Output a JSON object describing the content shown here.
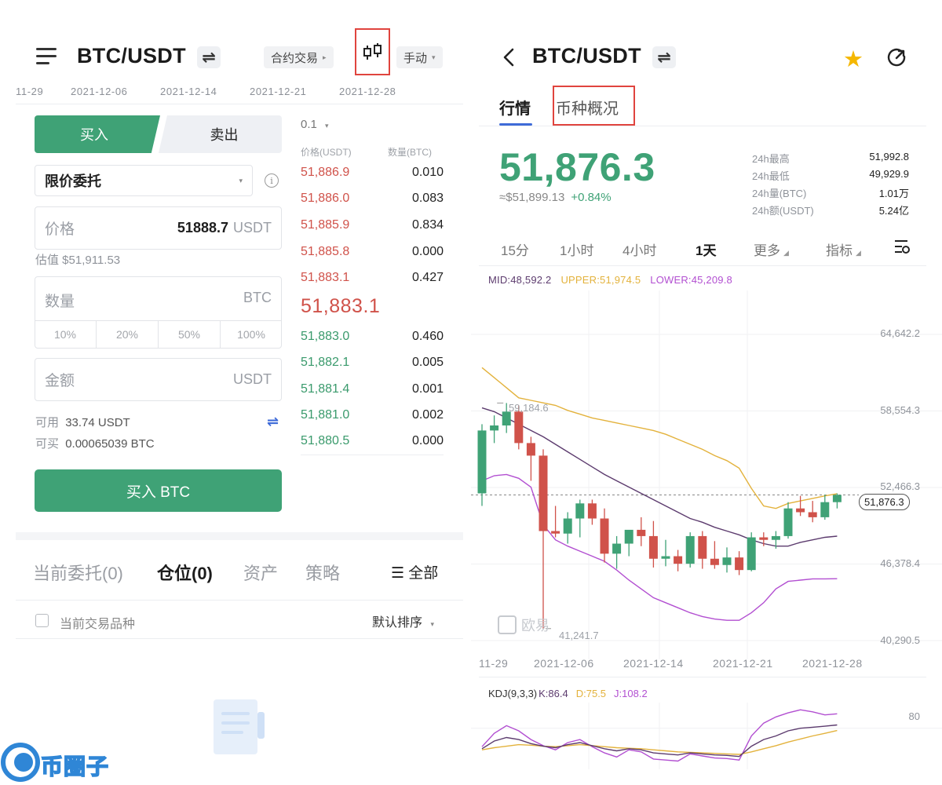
{
  "left": {
    "pair": "BTC/USDT",
    "swap_glyph": "⇌",
    "contract_label": "合约交易",
    "contract_arrow": "▸",
    "mode_label": "手动",
    "mode_caret": "▾",
    "dates": [
      "11-29",
      "2021-12-06",
      "2021-12-14",
      "2021-12-21",
      "2021-12-28"
    ],
    "buy_tab": "买入",
    "sell_tab": "卖出",
    "order_type": "限价委托",
    "order_type_caret": "▾",
    "info_glyph": "i",
    "price_label": "价格",
    "price_value": "51888.7",
    "price_unit": "USDT",
    "estimate": "估值 $51,911.53",
    "qty_label": "数量",
    "qty_unit": "BTC",
    "pcts": [
      "10%",
      "20%",
      "50%",
      "100%"
    ],
    "amount_label": "金额",
    "amount_unit": "USDT",
    "avail_label": "可用",
    "avail_value": "33.74 USDT",
    "canbuy_label": "可买",
    "canbuy_value": "0.00065039 BTC",
    "transfer_glyph": "⇌",
    "buy_button": "买入 BTC",
    "orderbook": {
      "step": "0.1",
      "step_caret": "▾",
      "head_price": "价格(USDT)",
      "head_qty": "数量(BTC)",
      "asks": [
        {
          "p": "51,886.9",
          "q": "0.010"
        },
        {
          "p": "51,886.0",
          "q": "0.083"
        },
        {
          "p": "51,885.9",
          "q": "0.834"
        },
        {
          "p": "51,885.8",
          "q": "0.000"
        },
        {
          "p": "51,883.1",
          "q": "0.427"
        }
      ],
      "mid": "51,883.1",
      "bids": [
        {
          "p": "51,883.0",
          "q": "0.460"
        },
        {
          "p": "51,882.1",
          "q": "0.005"
        },
        {
          "p": "51,881.4",
          "q": "0.001"
        },
        {
          "p": "51,881.0",
          "q": "0.002"
        },
        {
          "p": "51,880.5",
          "q": "0.000"
        }
      ]
    },
    "bottom_tabs": [
      "当前委托(0)",
      "仓位(0)",
      "资产",
      "策略"
    ],
    "active_bottom_tab": 1,
    "all_label": "☰ 全部",
    "current_pair_label": "当前交易品种",
    "sort_label": "默认排序",
    "sort_caret": "▾"
  },
  "right": {
    "back_glyph": "‹",
    "pair": "BTC/USDT",
    "swap_glyph": "⇌",
    "star_glyph": "★",
    "tabs": [
      "行情",
      "币种概况"
    ],
    "price": "51,876.3",
    "usd_price": "≈$51,899.13",
    "change": "+0.84%",
    "stats": [
      {
        "k": "24h最高",
        "v": "51,992.8"
      },
      {
        "k": "24h最低",
        "v": "49,929.9"
      },
      {
        "k": "24h量(BTC)",
        "v": "1.01万"
      },
      {
        "k": "24h额(USDT)",
        "v": "5.24亿"
      }
    ],
    "periods": [
      "15分",
      "1小时",
      "4小时",
      "1天",
      "更多",
      "指标"
    ],
    "active_period": 3,
    "boll": {
      "mid": "MID:48,592.2",
      "upper": "UPPER:51,974.5",
      "lower": "LOWER:45,209.8"
    },
    "y_ticks": [
      "64,642.2",
      "58,554.3",
      "52,466.3",
      "46,378.4",
      "40,290.5"
    ],
    "x_ticks": [
      "11-29",
      "2021-12-06",
      "2021-12-14",
      "2021-12-21",
      "2021-12-28"
    ],
    "max_label": "59,184.6",
    "min_label": "41,241.7",
    "last_price_tag": "51,876.3",
    "watermark": "欧易",
    "kdj": {
      "name": "KDJ(9,3,3)",
      "k": "K:86.4",
      "d": "D:75.5",
      "j": "J:108.2"
    },
    "kdj_tick": "80"
  },
  "colors": {
    "up": "#3fa276",
    "down": "#d0524a",
    "accent": "#3f6bd8",
    "highlight_box": "#e0443e",
    "boll_mid": "#5c3b6e",
    "boll_upper": "#e3b23c",
    "boll_lower": "#b24fd1",
    "kdj_k": "#5c3b6e",
    "kdj_d": "#e3b23c",
    "kdj_j": "#b24fd1"
  },
  "logo_text": "币圈子",
  "chart_data": {
    "type": "candlestick",
    "x_range": [
      "2021-11-29",
      "2021-12-28"
    ],
    "ylim": [
      40290.5,
      64642.2
    ],
    "candles": [
      {
        "o": 52000,
        "h": 57500,
        "l": 51000,
        "c": 57000
      },
      {
        "o": 57000,
        "h": 58200,
        "l": 56000,
        "c": 57400
      },
      {
        "o": 57400,
        "h": 59184.6,
        "l": 56800,
        "c": 58500
      },
      {
        "o": 58500,
        "h": 59000,
        "l": 55500,
        "c": 56000
      },
      {
        "o": 56000,
        "h": 56500,
        "l": 53000,
        "c": 55000
      },
      {
        "o": 55000,
        "h": 55500,
        "l": 41241.7,
        "c": 49000
      },
      {
        "o": 49000,
        "h": 51000,
        "l": 48500,
        "c": 48800
      },
      {
        "o": 48800,
        "h": 50500,
        "l": 48000,
        "c": 50000
      },
      {
        "o": 50000,
        "h": 51500,
        "l": 48500,
        "c": 51200
      },
      {
        "o": 51200,
        "h": 51500,
        "l": 49500,
        "c": 50000
      },
      {
        "o": 50000,
        "h": 50800,
        "l": 46500,
        "c": 47200
      },
      {
        "o": 47200,
        "h": 48600,
        "l": 46000,
        "c": 48000
      },
      {
        "o": 48000,
        "h": 49000,
        "l": 47000,
        "c": 49100
      },
      {
        "o": 49100,
        "h": 50100,
        "l": 47800,
        "c": 48600
      },
      {
        "o": 48600,
        "h": 49800,
        "l": 46100,
        "c": 46800
      },
      {
        "o": 46800,
        "h": 48300,
        "l": 46200,
        "c": 47000
      },
      {
        "o": 47000,
        "h": 47500,
        "l": 45800,
        "c": 46400
      },
      {
        "o": 46400,
        "h": 48900,
        "l": 46100,
        "c": 48600
      },
      {
        "o": 48600,
        "h": 49000,
        "l": 46000,
        "c": 46800
      },
      {
        "o": 46800,
        "h": 48200,
        "l": 46000,
        "c": 46300
      },
      {
        "o": 46300,
        "h": 47700,
        "l": 45700,
        "c": 46900
      },
      {
        "o": 46900,
        "h": 47400,
        "l": 45500,
        "c": 45900
      },
      {
        "o": 45900,
        "h": 48900,
        "l": 45800,
        "c": 48500
      },
      {
        "o": 48500,
        "h": 48900,
        "l": 47800,
        "c": 48300
      },
      {
        "o": 48300,
        "h": 49000,
        "l": 47600,
        "c": 48600
      },
      {
        "o": 48600,
        "h": 51300,
        "l": 48400,
        "c": 50800
      },
      {
        "o": 50800,
        "h": 51800,
        "l": 50200,
        "c": 50500
      },
      {
        "o": 50500,
        "h": 51400,
        "l": 49700,
        "c": 50100
      },
      {
        "o": 50100,
        "h": 51900,
        "l": 49900,
        "c": 51300
      },
      {
        "o": 51300,
        "h": 51992.8,
        "l": 50800,
        "c": 51876.3
      }
    ],
    "boll_upper": [
      62000,
      61200,
      60400,
      59600,
      59400,
      59200,
      59000,
      58600,
      58300,
      58000,
      57800,
      57600,
      57400,
      57200,
      57000,
      56700,
      56300,
      55900,
      55500,
      55000,
      54600,
      54000,
      52400,
      51000,
      50800,
      51200,
      51400,
      51600,
      51800,
      51974.5
    ],
    "boll_mid": [
      58800,
      58500,
      58000,
      57500,
      57000,
      56500,
      55900,
      55300,
      54700,
      54100,
      53500,
      53000,
      52500,
      52000,
      51500,
      51000,
      50500,
      50000,
      49700,
      49300,
      49000,
      48700,
      48300,
      48000,
      47800,
      47800,
      48100,
      48300,
      48500,
      48592.2
    ],
    "boll_lower": [
      53000,
      53400,
      53500,
      53200,
      52500,
      49500,
      48300,
      47800,
      47400,
      47000,
      46600,
      45900,
      45100,
      44400,
      43700,
      43300,
      42900,
      42500,
      42200,
      42000,
      41900,
      41900,
      42500,
      43300,
      44400,
      45000,
      45100,
      45200,
      45200,
      45209.8
    ],
    "kdj_k": [
      40,
      55,
      62,
      58,
      50,
      45,
      42,
      48,
      52,
      46,
      40,
      36,
      40,
      38,
      32,
      30,
      28,
      32,
      30,
      28,
      27,
      25,
      45,
      58,
      65,
      75,
      80,
      82,
      84,
      86.4
    ],
    "kdj_d": [
      38,
      42,
      45,
      48,
      47,
      45,
      44,
      46,
      48,
      46,
      44,
      42,
      41,
      40,
      38,
      36,
      34,
      33,
      32,
      31,
      30,
      29,
      34,
      40,
      46,
      53,
      59,
      65,
      70,
      75.5
    ],
    "kdj_j": [
      44,
      70,
      85,
      75,
      58,
      46,
      38,
      52,
      58,
      44,
      32,
      24,
      38,
      34,
      20,
      18,
      16,
      30,
      26,
      22,
      21,
      18,
      65,
      90,
      102,
      110,
      116,
      112,
      106,
      108.2
    ],
    "kdj_tick": 80
  }
}
